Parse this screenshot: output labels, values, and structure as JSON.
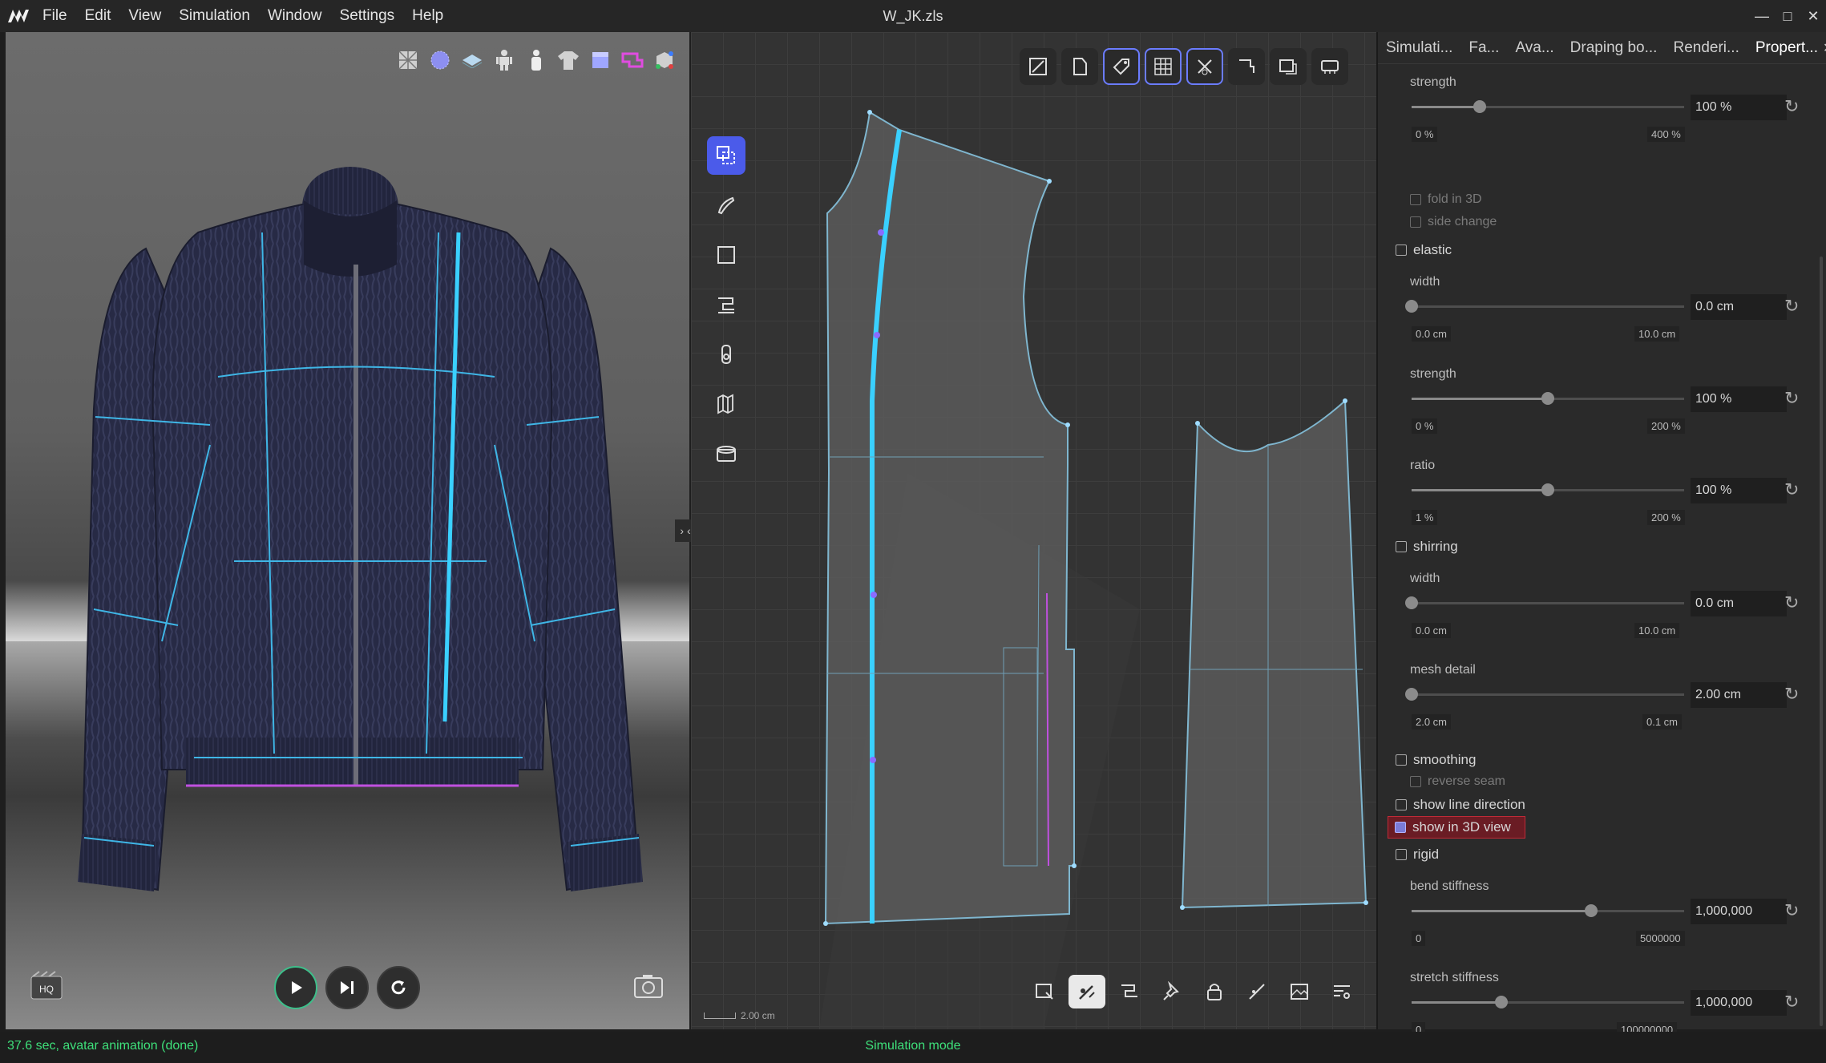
{
  "app": {
    "title": "W_JK.zls",
    "menu": [
      "File",
      "Edit",
      "View",
      "Simulation",
      "Window",
      "Settings",
      "Help"
    ]
  },
  "view3d": {
    "toolbar_icons": [
      "fabric-icon",
      "sphere-icon",
      "plane-icon",
      "avatar-icon",
      "avatar-solid-icon",
      "garment-icon",
      "cube-icon",
      "sewing-icon",
      "axis-icon"
    ],
    "hq_label": "HQ"
  },
  "view2d": {
    "scale_label": "2.00 cm"
  },
  "panel": {
    "tabs": [
      "Simulati...",
      "Fa...",
      "Ava...",
      "Draping bo...",
      "Renderi...",
      "Propert..."
    ],
    "strength_top": {
      "label": "strength",
      "value": "100 %",
      "min": "0 %",
      "max": "400 %",
      "fraction": 0.25
    },
    "fold_in_3d": "fold in 3D",
    "side_change": "side change",
    "elastic": "elastic",
    "elastic_width": {
      "label": "width",
      "value": "0.0 cm",
      "min": "0.0 cm",
      "max": "10.0 cm",
      "fraction": 0.0
    },
    "elastic_strength": {
      "label": "strength",
      "value": "100 %",
      "min": "0 %",
      "max": "200 %",
      "fraction": 0.5
    },
    "ratio": {
      "label": "ratio",
      "value": "100 %",
      "min": "1 %",
      "max": "200 %",
      "fraction": 0.5
    },
    "shirring": "shirring",
    "shirring_width": {
      "label": "width",
      "value": "0.0 cm",
      "min": "0.0 cm",
      "max": "10.0 cm",
      "fraction": 0.0
    },
    "mesh_detail": {
      "label": "mesh detail",
      "value": "2.00 cm",
      "min": "2.0 cm",
      "max": "0.1 cm",
      "fraction": 0.0
    },
    "smoothing": "smoothing",
    "reverse_seam": "reverse seam",
    "show_line_direction": "show line direction",
    "show_in_3d_view": "show in 3D view",
    "rigid": "rigid",
    "bend_stiffness": {
      "label": "bend stiffness",
      "value": "1,000,000",
      "min": "0",
      "max": "5000000",
      "fraction": 0.66
    },
    "stretch_stiffness": {
      "label": "stretch stiffness",
      "value": "1,000,000",
      "min": "0",
      "max": "100000000",
      "fraction": 0.33
    }
  },
  "status": {
    "left": "37.6 sec, avatar animation (done)",
    "mode": "Simulation mode"
  }
}
